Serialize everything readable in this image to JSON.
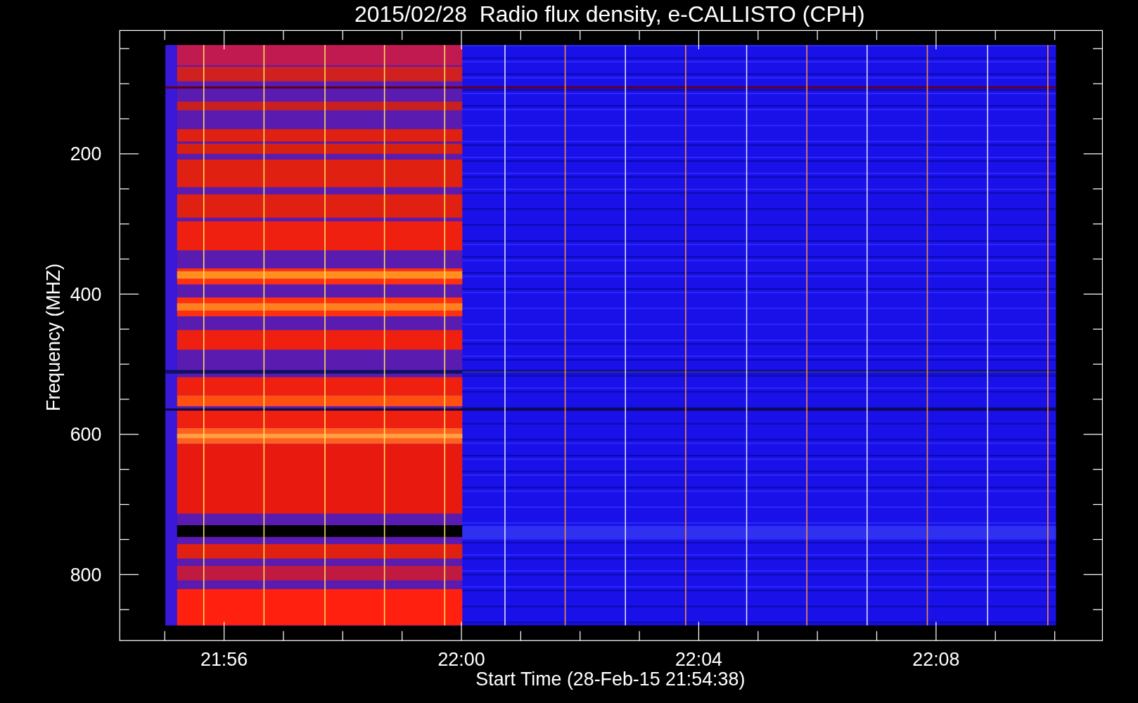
{
  "title": "2015/02/28  Radio flux density, e-CALLISTO (CPH)",
  "ylabel": "Frequency (MHZ)",
  "xlabel": "Start Time (28-Feb-15 21:54:38)",
  "y_tick_labels": [
    "200",
    "400",
    "600",
    "800"
  ],
  "x_tick_labels": [
    "21:56",
    "22:00",
    "22:04",
    "22:08"
  ]
}
